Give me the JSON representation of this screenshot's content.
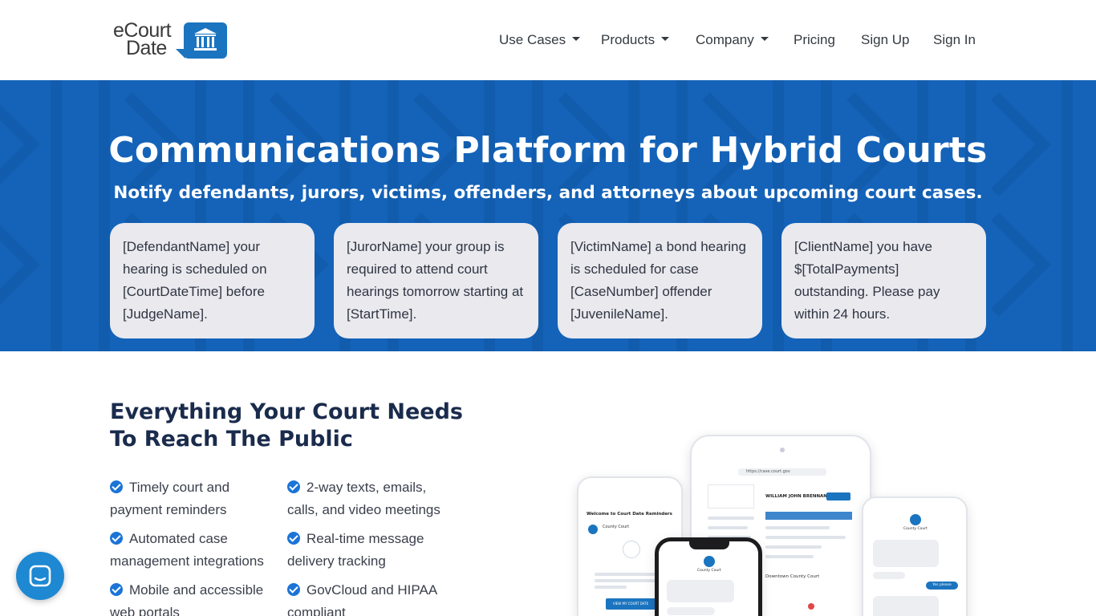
{
  "brand": {
    "line1": "eCourt",
    "line2": "Date",
    "color": "#1b74bf"
  },
  "nav": {
    "items": [
      {
        "label": "Use Cases",
        "dropdown": true
      },
      {
        "label": "Products",
        "dropdown": true
      },
      {
        "label": "Company",
        "dropdown": true
      },
      {
        "label": "Pricing",
        "dropdown": false
      },
      {
        "label": "Sign Up",
        "dropdown": false
      },
      {
        "label": "Sign In",
        "dropdown": false
      }
    ]
  },
  "hero": {
    "title": "Communications Platform for Hybrid Courts",
    "subtitle": "Notify defendants, jurors, victims, offenders, and attorneys about upcoming court cases.",
    "background": "#1463b9",
    "cards": [
      {
        "text": "[DefendantName] your hearing is scheduled on [CourtDateTime] before [JudgeName]."
      },
      {
        "text": "[JurorName] your group is required to attend court hearings tomorrow starting at [StartTime]."
      },
      {
        "text": "[VictimName] a bond hearing is scheduled for case [CaseNumber] offender [JuvenileName]."
      },
      {
        "text": "[ClientName] you have $[TotalPayments] outstanding. Please pay within 24 hours."
      }
    ]
  },
  "features": {
    "title": "Everything Your Court Needs To Reach The Public",
    "items": [
      "Timely court and payment reminders",
      "2-way texts, emails, calls, and video meetings",
      "Automated case management integrations",
      "Real-time message delivery tracking",
      "Mobile and accessible web portals",
      "GovCloud and HIPAA compliant"
    ]
  },
  "devices": {
    "phone_left_header": "Welcome to Court Date Reminders",
    "phone_left_sender": "County Court",
    "phone_left_button": "VIEW MY COURT DATE",
    "tablet_url": "https://case.court.gov",
    "tablet_name": "WILLIAM JOHN BRENNAN",
    "tablet_place": "Downtown County Court",
    "phone_center_sender": "County Court",
    "phone_right_sender": "County Court",
    "phone_right_reply": "Yes please"
  },
  "chat_widget": {
    "icon": "chat-icon"
  }
}
